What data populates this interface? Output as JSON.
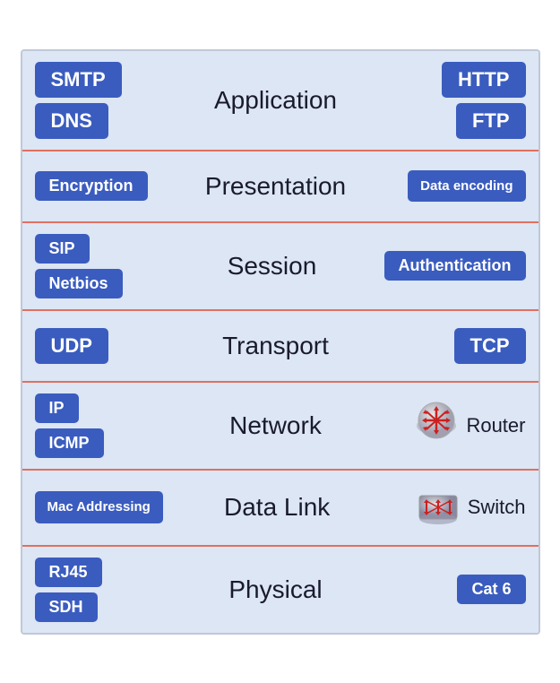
{
  "layers": [
    {
      "id": "application",
      "name": "Application",
      "left_badges": [
        "SMTP",
        "DNS"
      ],
      "right_badges": [
        "HTTP",
        "FTP"
      ],
      "left_badge_sizes": [
        "large",
        "large"
      ],
      "right_badge_sizes": [
        "large",
        "large"
      ],
      "has_device": false
    },
    {
      "id": "presentation",
      "name": "Presentation",
      "left_badges": [
        "Encryption"
      ],
      "right_badges": [
        "Data\nencoding"
      ],
      "left_badge_sizes": [
        "medium"
      ],
      "right_badge_sizes": [
        "multiline"
      ],
      "has_device": false
    },
    {
      "id": "session",
      "name": "Session",
      "left_badges": [
        "SIP",
        "Netbios"
      ],
      "right_badges": [
        "Authentication"
      ],
      "left_badge_sizes": [
        "medium",
        "medium"
      ],
      "right_badge_sizes": [
        "medium"
      ],
      "has_device": false
    },
    {
      "id": "transport",
      "name": "Transport",
      "left_badges": [
        "UDP"
      ],
      "right_badges": [
        "TCP"
      ],
      "left_badge_sizes": [
        "large"
      ],
      "right_badge_sizes": [
        "large"
      ],
      "has_device": false
    },
    {
      "id": "network",
      "name": "Network",
      "left_badges": [
        "IP",
        "ICMP"
      ],
      "right_badges": [],
      "left_badge_sizes": [
        "medium",
        "medium"
      ],
      "right_badge_sizes": [],
      "has_device": true,
      "device_type": "router",
      "device_label": "Router"
    },
    {
      "id": "datalink",
      "name": "Data Link",
      "left_badges": [
        "Mac\nAddressing"
      ],
      "right_badges": [],
      "left_badge_sizes": [
        "multiline"
      ],
      "right_badge_sizes": [],
      "has_device": true,
      "device_type": "switch",
      "device_label": "Switch"
    },
    {
      "id": "physical",
      "name": "Physical",
      "left_badges": [
        "RJ45",
        "SDH"
      ],
      "right_badges": [
        "Cat 6"
      ],
      "left_badge_sizes": [
        "medium",
        "medium"
      ],
      "right_badge_sizes": [
        "medium"
      ],
      "has_device": false
    }
  ]
}
